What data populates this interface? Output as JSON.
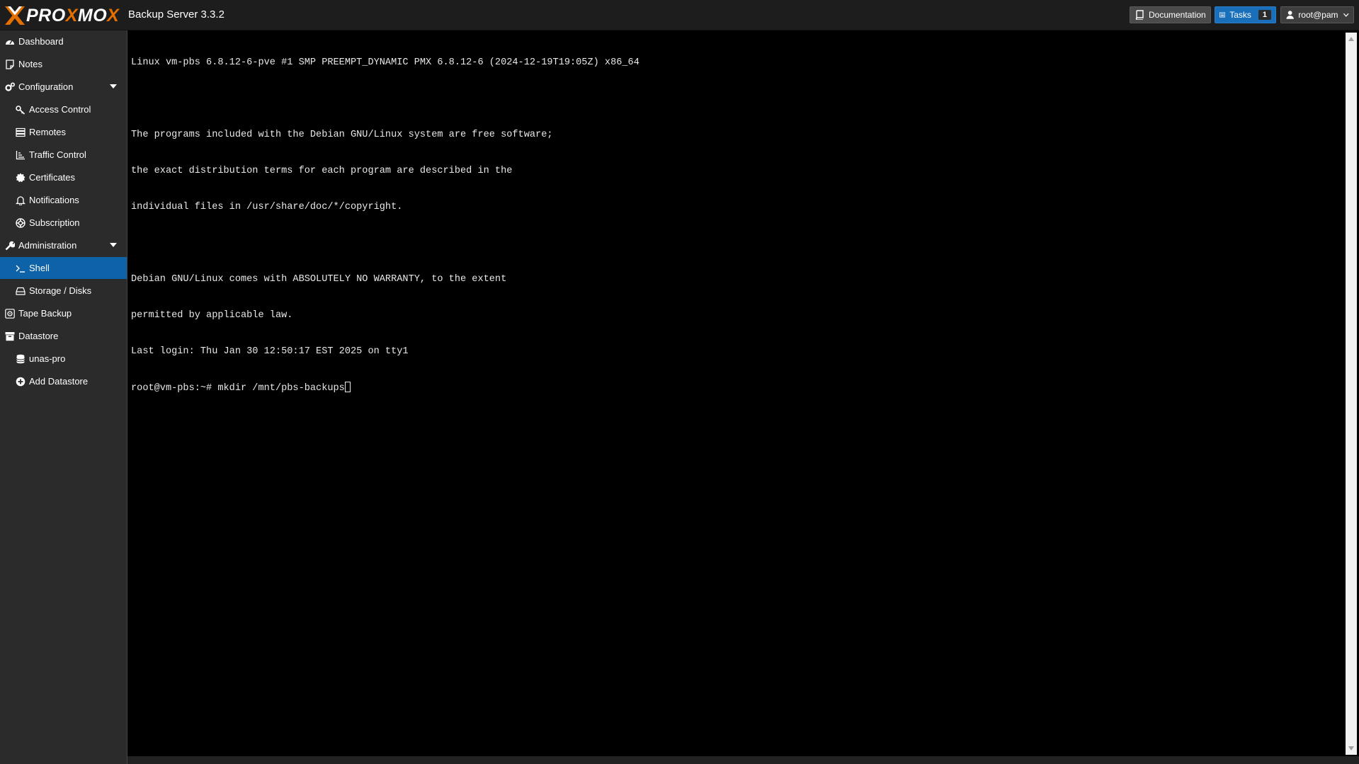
{
  "header": {
    "logo_text_a": "PRO",
    "logo_text_x": "X",
    "logo_text_b": "MO",
    "logo_text_x2": "X",
    "product": "Backup Server 3.3.2",
    "documentation_label": "Documentation",
    "tasks_label": "Tasks",
    "tasks_count": "1",
    "user_label": "root@pam",
    "accent_color": "#e57000",
    "tasks_color": "#1a6fba"
  },
  "sidebar": {
    "items": [
      {
        "label": "Dashboard",
        "icon": "dashboard-icon"
      },
      {
        "label": "Notes",
        "icon": "notes-icon"
      },
      {
        "label": "Configuration",
        "icon": "gears-icon"
      },
      {
        "label": "Access Control",
        "icon": "key-icon"
      },
      {
        "label": "Remotes",
        "icon": "server-icon"
      },
      {
        "label": "Traffic Control",
        "icon": "traffic-chart-icon"
      },
      {
        "label": "Certificates",
        "icon": "certificate-icon"
      },
      {
        "label": "Notifications",
        "icon": "bell-icon"
      },
      {
        "label": "Subscription",
        "icon": "support-icon"
      },
      {
        "label": "Administration",
        "icon": "wrench-icon"
      },
      {
        "label": "Shell",
        "icon": "terminal-icon"
      },
      {
        "label": "Storage / Disks",
        "icon": "hdd-icon"
      },
      {
        "label": "Tape Backup",
        "icon": "tape-icon"
      },
      {
        "label": "Datastore",
        "icon": "archive-icon"
      },
      {
        "label": "unas-pro",
        "icon": "database-icon"
      },
      {
        "label": "Add Datastore",
        "icon": "plus-circle-icon"
      }
    ],
    "active_color": "#0d62a8"
  },
  "terminal": {
    "lines": [
      "Linux vm-pbs 6.8.12-6-pve #1 SMP PREEMPT_DYNAMIC PMX 6.8.12-6 (2024-12-19T19:05Z) x86_64",
      "",
      "The programs included with the Debian GNU/Linux system are free software;",
      "the exact distribution terms for each program are described in the",
      "individual files in /usr/share/doc/*/copyright.",
      "",
      "Debian GNU/Linux comes with ABSOLUTELY NO WARRANTY, to the extent",
      "permitted by applicable law.",
      "Last login: Thu Jan 30 12:50:17 EST 2025 on tty1"
    ],
    "prompt": "root@vm-pbs:~# mkdir /mnt/pbs-backups"
  }
}
